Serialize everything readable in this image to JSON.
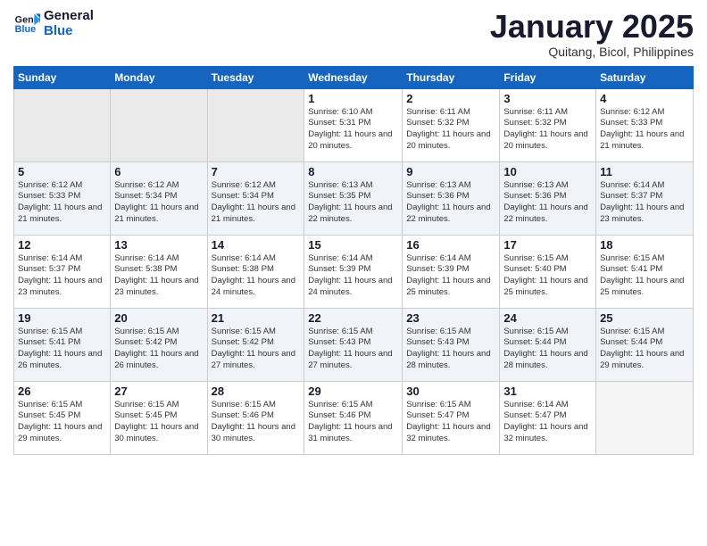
{
  "app": {
    "logo_line1": "General",
    "logo_line2": "Blue"
  },
  "header": {
    "month": "January 2025",
    "location": "Quitang, Bicol, Philippines"
  },
  "weekdays": [
    "Sunday",
    "Monday",
    "Tuesday",
    "Wednesday",
    "Thursday",
    "Friday",
    "Saturday"
  ],
  "weeks": [
    {
      "row_class": "week-row-1",
      "days": [
        {
          "num": "",
          "info": "",
          "empty": true
        },
        {
          "num": "",
          "info": "",
          "empty": true
        },
        {
          "num": "",
          "info": "",
          "empty": true
        },
        {
          "num": "1",
          "info": "Sunrise: 6:10 AM\nSunset: 5:31 PM\nDaylight: 11 hours\nand 20 minutes.",
          "empty": false
        },
        {
          "num": "2",
          "info": "Sunrise: 6:11 AM\nSunset: 5:32 PM\nDaylight: 11 hours\nand 20 minutes.",
          "empty": false
        },
        {
          "num": "3",
          "info": "Sunrise: 6:11 AM\nSunset: 5:32 PM\nDaylight: 11 hours\nand 20 minutes.",
          "empty": false
        },
        {
          "num": "4",
          "info": "Sunrise: 6:12 AM\nSunset: 5:33 PM\nDaylight: 11 hours\nand 21 minutes.",
          "empty": false
        }
      ]
    },
    {
      "row_class": "week-row-2",
      "days": [
        {
          "num": "5",
          "info": "Sunrise: 6:12 AM\nSunset: 5:33 PM\nDaylight: 11 hours\nand 21 minutes.",
          "empty": false
        },
        {
          "num": "6",
          "info": "Sunrise: 6:12 AM\nSunset: 5:34 PM\nDaylight: 11 hours\nand 21 minutes.",
          "empty": false
        },
        {
          "num": "7",
          "info": "Sunrise: 6:12 AM\nSunset: 5:34 PM\nDaylight: 11 hours\nand 21 minutes.",
          "empty": false
        },
        {
          "num": "8",
          "info": "Sunrise: 6:13 AM\nSunset: 5:35 PM\nDaylight: 11 hours\nand 22 minutes.",
          "empty": false
        },
        {
          "num": "9",
          "info": "Sunrise: 6:13 AM\nSunset: 5:36 PM\nDaylight: 11 hours\nand 22 minutes.",
          "empty": false
        },
        {
          "num": "10",
          "info": "Sunrise: 6:13 AM\nSunset: 5:36 PM\nDaylight: 11 hours\nand 22 minutes.",
          "empty": false
        },
        {
          "num": "11",
          "info": "Sunrise: 6:14 AM\nSunset: 5:37 PM\nDaylight: 11 hours\nand 23 minutes.",
          "empty": false
        }
      ]
    },
    {
      "row_class": "week-row-3",
      "days": [
        {
          "num": "12",
          "info": "Sunrise: 6:14 AM\nSunset: 5:37 PM\nDaylight: 11 hours\nand 23 minutes.",
          "empty": false
        },
        {
          "num": "13",
          "info": "Sunrise: 6:14 AM\nSunset: 5:38 PM\nDaylight: 11 hours\nand 23 minutes.",
          "empty": false
        },
        {
          "num": "14",
          "info": "Sunrise: 6:14 AM\nSunset: 5:38 PM\nDaylight: 11 hours\nand 24 minutes.",
          "empty": false
        },
        {
          "num": "15",
          "info": "Sunrise: 6:14 AM\nSunset: 5:39 PM\nDaylight: 11 hours\nand 24 minutes.",
          "empty": false
        },
        {
          "num": "16",
          "info": "Sunrise: 6:14 AM\nSunset: 5:39 PM\nDaylight: 11 hours\nand 25 minutes.",
          "empty": false
        },
        {
          "num": "17",
          "info": "Sunrise: 6:15 AM\nSunset: 5:40 PM\nDaylight: 11 hours\nand 25 minutes.",
          "empty": false
        },
        {
          "num": "18",
          "info": "Sunrise: 6:15 AM\nSunset: 5:41 PM\nDaylight: 11 hours\nand 25 minutes.",
          "empty": false
        }
      ]
    },
    {
      "row_class": "week-row-4",
      "days": [
        {
          "num": "19",
          "info": "Sunrise: 6:15 AM\nSunset: 5:41 PM\nDaylight: 11 hours\nand 26 minutes.",
          "empty": false
        },
        {
          "num": "20",
          "info": "Sunrise: 6:15 AM\nSunset: 5:42 PM\nDaylight: 11 hours\nand 26 minutes.",
          "empty": false
        },
        {
          "num": "21",
          "info": "Sunrise: 6:15 AM\nSunset: 5:42 PM\nDaylight: 11 hours\nand 27 minutes.",
          "empty": false
        },
        {
          "num": "22",
          "info": "Sunrise: 6:15 AM\nSunset: 5:43 PM\nDaylight: 11 hours\nand 27 minutes.",
          "empty": false
        },
        {
          "num": "23",
          "info": "Sunrise: 6:15 AM\nSunset: 5:43 PM\nDaylight: 11 hours\nand 28 minutes.",
          "empty": false
        },
        {
          "num": "24",
          "info": "Sunrise: 6:15 AM\nSunset: 5:44 PM\nDaylight: 11 hours\nand 28 minutes.",
          "empty": false
        },
        {
          "num": "25",
          "info": "Sunrise: 6:15 AM\nSunset: 5:44 PM\nDaylight: 11 hours\nand 29 minutes.",
          "empty": false
        }
      ]
    },
    {
      "row_class": "week-row-5",
      "days": [
        {
          "num": "26",
          "info": "Sunrise: 6:15 AM\nSunset: 5:45 PM\nDaylight: 11 hours\nand 29 minutes.",
          "empty": false
        },
        {
          "num": "27",
          "info": "Sunrise: 6:15 AM\nSunset: 5:45 PM\nDaylight: 11 hours\nand 30 minutes.",
          "empty": false
        },
        {
          "num": "28",
          "info": "Sunrise: 6:15 AM\nSunset: 5:46 PM\nDaylight: 11 hours\nand 30 minutes.",
          "empty": false
        },
        {
          "num": "29",
          "info": "Sunrise: 6:15 AM\nSunset: 5:46 PM\nDaylight: 11 hours\nand 31 minutes.",
          "empty": false
        },
        {
          "num": "30",
          "info": "Sunrise: 6:15 AM\nSunset: 5:47 PM\nDaylight: 11 hours\nand 32 minutes.",
          "empty": false
        },
        {
          "num": "31",
          "info": "Sunrise: 6:14 AM\nSunset: 5:47 PM\nDaylight: 11 hours\nand 32 minutes.",
          "empty": false
        },
        {
          "num": "",
          "info": "",
          "empty": true
        }
      ]
    }
  ]
}
